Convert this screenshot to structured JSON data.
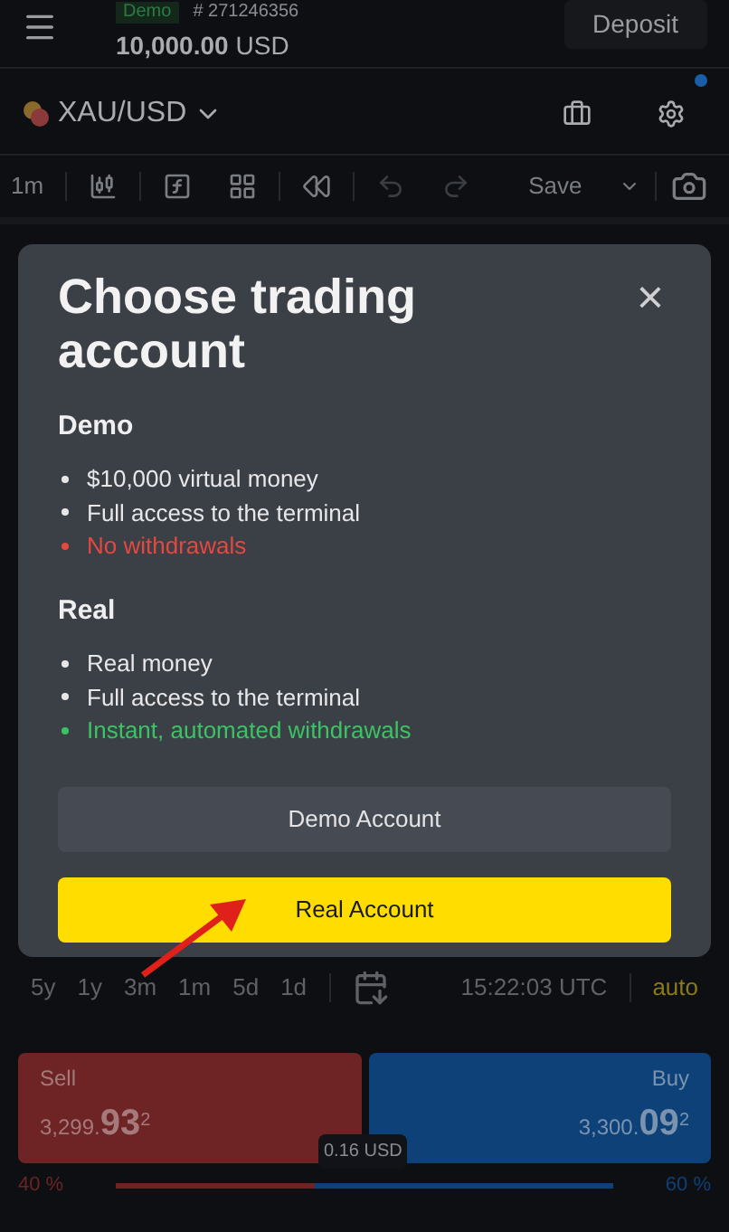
{
  "account": {
    "badge": "Demo",
    "number": "# 271246356",
    "balance_amount": "10,000.00",
    "balance_currency": "USD",
    "deposit": "Deposit"
  },
  "symbol": {
    "label": "XAU/USD",
    "notification": true
  },
  "toolbar": {
    "interval": "1m",
    "save": "Save"
  },
  "dialog": {
    "title": "Choose trading account",
    "close": "×",
    "sections": [
      {
        "heading": "Demo",
        "items": [
          {
            "text": "$10,000 virtual money",
            "kind": "plain"
          },
          {
            "text": "Full access to the terminal",
            "kind": "plain"
          },
          {
            "text": "No withdrawals",
            "kind": "negative"
          }
        ]
      },
      {
        "heading": "Real",
        "items": [
          {
            "text": "Real money",
            "kind": "plain"
          },
          {
            "text": "Full access to the terminal",
            "kind": "plain"
          },
          {
            "text": "Instant, automated withdrawals",
            "kind": "positive"
          }
        ]
      }
    ],
    "buttons": [
      {
        "label": "Demo Account",
        "kind": "secondary"
      },
      {
        "label": "Real Account",
        "kind": "primary"
      }
    ]
  },
  "ranges": [
    {
      "label": "5y"
    },
    {
      "label": "1y"
    },
    {
      "label": "3m"
    },
    {
      "label": "1m"
    },
    {
      "label": "5d"
    },
    {
      "label": "1d"
    }
  ],
  "clock": "15:22:03 UTC",
  "scale_mode": "auto",
  "sell": {
    "label": "Sell",
    "price_main": "3,299.",
    "price_big": "93",
    "price_sup": "2"
  },
  "buy": {
    "label": "Buy",
    "price_main": "3,300.",
    "price_big": "09",
    "price_sup": "2"
  },
  "spread": "0.16 USD",
  "sentiment": {
    "sell_share": "40 %",
    "buy_share": "60 %",
    "level": 0.4
  }
}
